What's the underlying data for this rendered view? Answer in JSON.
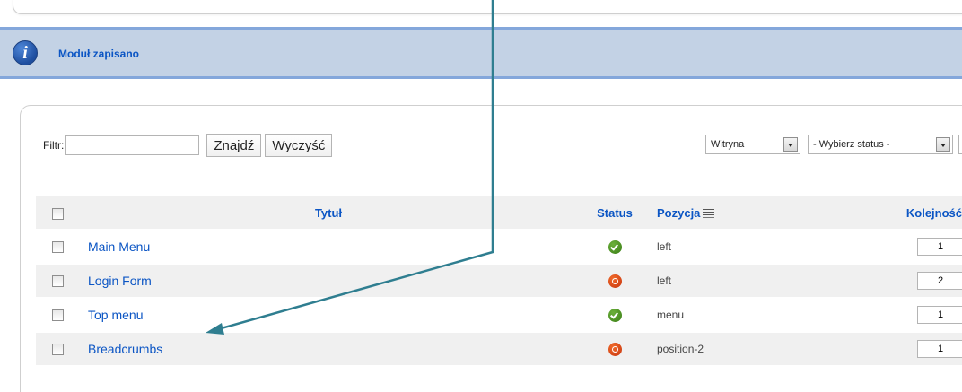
{
  "message": {
    "text": "Moduł zapisano"
  },
  "filter": {
    "label": "Filtr:",
    "value": "",
    "find_label": "Znajdź",
    "clear_label": "Wyczyść"
  },
  "selects": {
    "site": "Witryna",
    "status": "- Wybierz status -"
  },
  "table": {
    "headers": {
      "title": "Tytuł",
      "status": "Status",
      "position": "Pozycja",
      "order": "Kolejność"
    },
    "rows": [
      {
        "title": "Main Menu",
        "status": "published",
        "position": "left",
        "order": "1"
      },
      {
        "title": "Login Form",
        "status": "unpublished",
        "position": "left",
        "order": "2"
      },
      {
        "title": "Top menu",
        "status": "published",
        "position": "menu",
        "order": "1"
      },
      {
        "title": "Breadcrumbs",
        "status": "unpublished",
        "position": "position-2",
        "order": "1"
      }
    ]
  },
  "colors": {
    "link": "#0b55c4",
    "message_bg": "#c3d2e5",
    "arrow": "#2f7e90",
    "published": "#3a7d16",
    "unpublished": "#c8360f"
  }
}
